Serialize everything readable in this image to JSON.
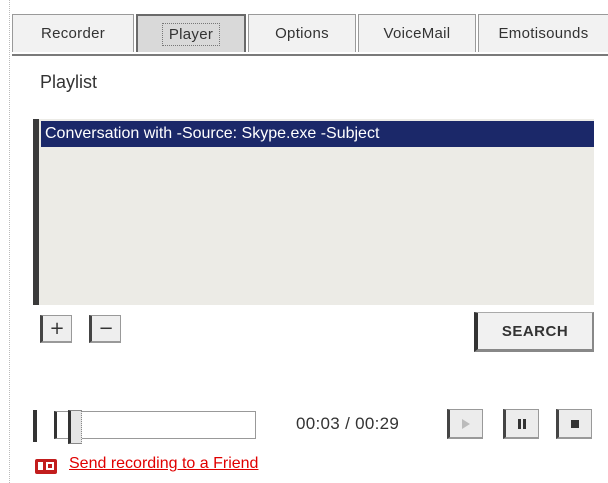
{
  "tabs": [
    {
      "label": "Recorder",
      "active": false
    },
    {
      "label": "Player",
      "active": true
    },
    {
      "label": "Options",
      "active": false
    },
    {
      "label": "VoiceMail",
      "active": false
    },
    {
      "label": "Emotisounds",
      "active": false
    }
  ],
  "playlist": {
    "label": "Playlist",
    "items": [
      {
        "text": "Conversation with -Source: Skype.exe -Subject",
        "selected": true
      }
    ]
  },
  "buttons": {
    "add": "+",
    "remove": "−",
    "search": "SEARCH"
  },
  "player": {
    "time": "00:03 / 00:29",
    "progress_fraction": 0.06,
    "controls": [
      "play-icon",
      "pause-icon",
      "stop-icon"
    ]
  },
  "footer": {
    "send_link": "Send recording to a Friend",
    "send_icon": "email-icon"
  },
  "colors": {
    "selection": "#1b2869",
    "link": "#e00000",
    "list_bg": "#ecebe6"
  }
}
